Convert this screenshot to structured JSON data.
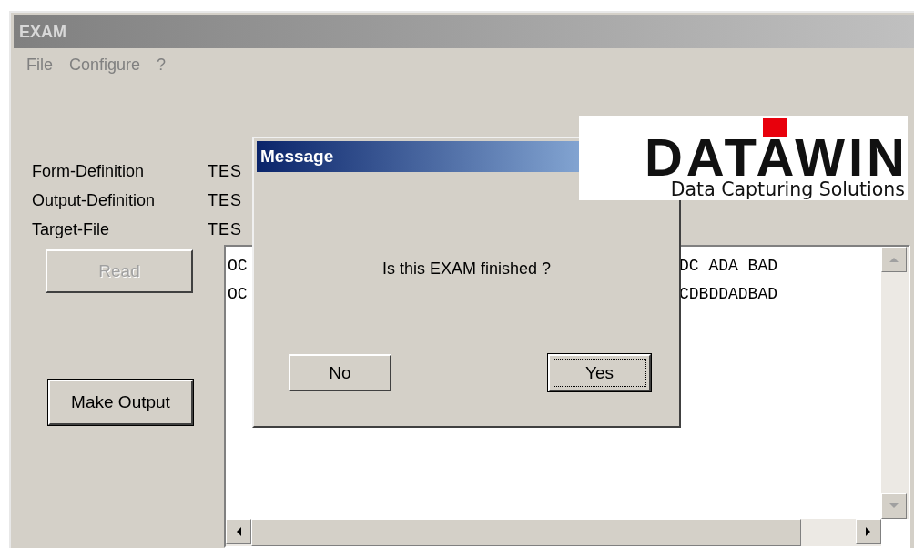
{
  "window": {
    "title": "EXAM"
  },
  "menu": [
    "File",
    "Configure",
    "?"
  ],
  "logo": {
    "name": "DATAWIN",
    "tagline": "Data Capturing Solutions"
  },
  "fields": [
    {
      "label": "Form-Definition",
      "value": "TES"
    },
    {
      "label": "Output-Definition",
      "value": "TES"
    },
    {
      "label": "Target-File",
      "value": "TES"
    }
  ],
  "buttons": [
    {
      "label": "Read",
      "disabled": true
    },
    {
      "label": "Make Output",
      "disabled": false
    }
  ],
  "output_lines": [
    {
      "column_1": "OC",
      "column_2": "DC ADA BAD"
    },
    {
      "column_1": "OC",
      "column_2": "CDBDDADBAD"
    }
  ],
  "dialog": {
    "title": "Message",
    "message": "Is this EXAM finished ?",
    "buttons": [
      {
        "label": "No",
        "focused": false
      },
      {
        "label": "Yes",
        "focused": true
      }
    ]
  }
}
